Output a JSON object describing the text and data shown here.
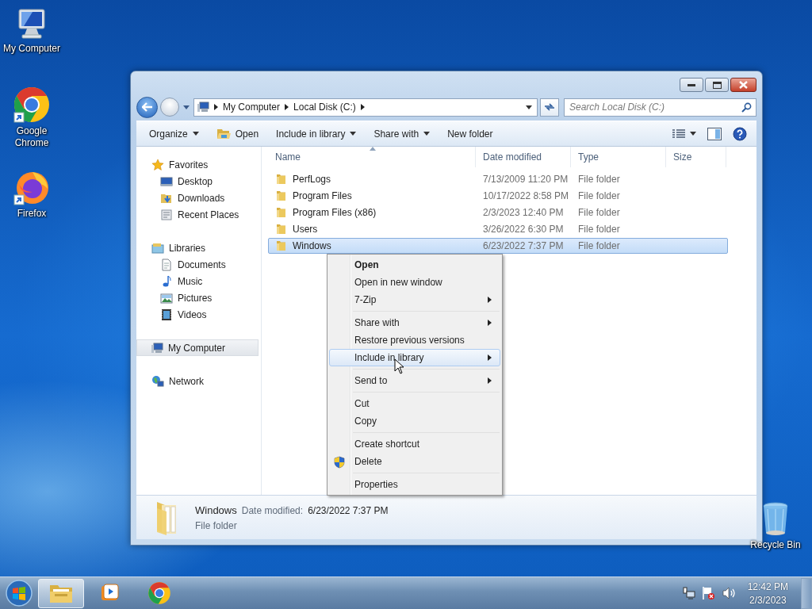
{
  "desktop_icons": [
    {
      "label": "My Computer",
      "kind": "computer"
    },
    {
      "label": "Google Chrome",
      "kind": "chrome"
    },
    {
      "label": "Firefox",
      "kind": "firefox"
    },
    {
      "label": "Recycle Bin",
      "kind": "recycle"
    }
  ],
  "window": {
    "address": {
      "crumbs": [
        "My Computer",
        "Local Disk (C:)"
      ]
    },
    "search": {
      "placeholder": "Search Local Disk (C:)"
    },
    "toolbar": [
      {
        "label": "Organize",
        "kind": "dropdown"
      },
      {
        "label": "Open",
        "kind": "icon"
      },
      {
        "label": "Include in library",
        "kind": "dropdown"
      },
      {
        "label": "Share with",
        "kind": "dropdown"
      },
      {
        "label": "New folder",
        "kind": "plain"
      }
    ],
    "sidebar": [
      {
        "label": "Favorites",
        "kind": "star",
        "selected": false,
        "children": [
          {
            "label": "Desktop",
            "kind": "desktop",
            "selected": false
          },
          {
            "label": "Downloads",
            "kind": "downloads",
            "selected": false
          },
          {
            "label": "Recent Places",
            "kind": "recent",
            "selected": false
          }
        ]
      },
      {
        "label": "Libraries",
        "kind": "library",
        "selected": false,
        "children": [
          {
            "label": "Documents",
            "kind": "documents",
            "selected": false
          },
          {
            "label": "Music",
            "kind": "music",
            "selected": false
          },
          {
            "label": "Pictures",
            "kind": "pictures",
            "selected": false
          },
          {
            "label": "Videos",
            "kind": "videos",
            "selected": false
          }
        ]
      },
      {
        "label": "My Computer",
        "kind": "computer",
        "selected": true
      },
      {
        "label": "Network",
        "kind": "network",
        "selected": false
      }
    ],
    "columns": [
      "Name",
      "Date modified",
      "Type",
      "Size"
    ],
    "rows": [
      {
        "name": "PerfLogs",
        "date_modified": "7/13/2009 11:20 PM",
        "type": "File folder",
        "selected": false
      },
      {
        "name": "Program Files",
        "date_modified": "10/17/2022 8:58 PM",
        "type": "File folder",
        "selected": false
      },
      {
        "name": "Program Files (x86)",
        "date_modified": "2/3/2023 12:40 PM",
        "type": "File folder",
        "selected": false
      },
      {
        "name": "Users",
        "date_modified": "3/26/2022 6:30 PM",
        "type": "File folder",
        "selected": false
      },
      {
        "name": "Windows",
        "date_modified": "6/23/2022 7:37 PM",
        "type": "File folder",
        "selected": true
      }
    ],
    "details": {
      "name": "Windows",
      "label": "Date modified:",
      "value": "6/23/2022 7:37 PM",
      "type": "File folder"
    }
  },
  "context_menu": {
    "groups": [
      [
        {
          "label": "Open",
          "bold": true,
          "submenu": false,
          "selected": false,
          "shield": false
        },
        {
          "label": "Open in new window",
          "bold": false,
          "submenu": false,
          "selected": false,
          "shield": false
        },
        {
          "label": "7-Zip",
          "bold": false,
          "submenu": true,
          "selected": false,
          "shield": false
        }
      ],
      [
        {
          "label": "Share with",
          "bold": false,
          "submenu": true,
          "selected": false,
          "shield": false
        },
        {
          "label": "Restore previous versions",
          "bold": false,
          "submenu": false,
          "selected": false,
          "shield": false
        },
        {
          "label": "Include in library",
          "bold": false,
          "submenu": true,
          "selected": true,
          "shield": false
        }
      ],
      [
        {
          "label": "Send to",
          "bold": false,
          "submenu": true,
          "selected": false,
          "shield": false
        }
      ],
      [
        {
          "label": "Cut",
          "bold": false,
          "submenu": false,
          "selected": false,
          "shield": false
        },
        {
          "label": "Copy",
          "bold": false,
          "submenu": false,
          "selected": false,
          "shield": false
        }
      ],
      [
        {
          "label": "Create shortcut",
          "bold": false,
          "submenu": false,
          "selected": false,
          "shield": false
        },
        {
          "label": "Delete",
          "bold": false,
          "submenu": false,
          "selected": false,
          "shield": true
        }
      ],
      [
        {
          "label": "Properties",
          "bold": false,
          "submenu": false,
          "selected": false,
          "shield": false
        }
      ]
    ]
  },
  "taskbar": {
    "apps": [
      {
        "kind": "explorer",
        "selected": true
      },
      {
        "kind": "media",
        "selected": false
      },
      {
        "kind": "chrome",
        "selected": false
      }
    ],
    "clock": {
      "time": "12:42 PM",
      "date": "2/3/2023"
    }
  }
}
